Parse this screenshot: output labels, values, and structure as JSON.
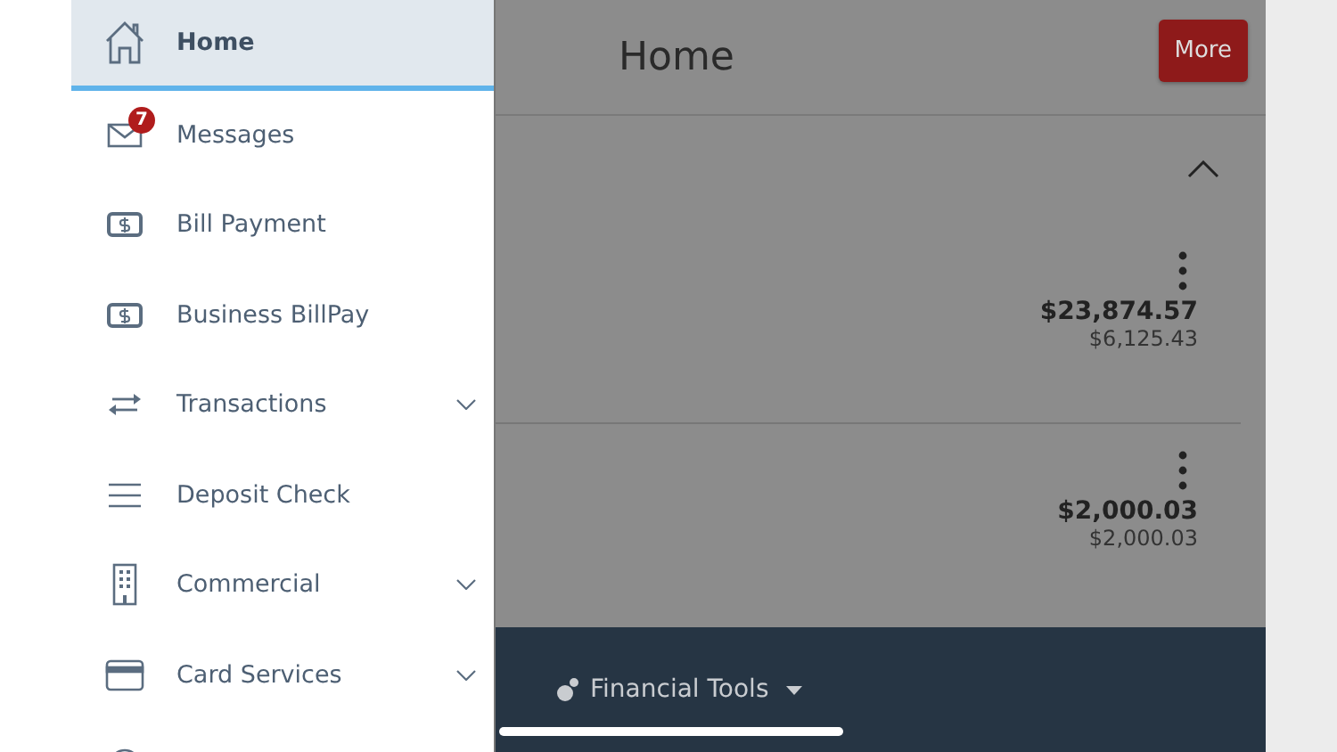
{
  "menu": [
    {
      "label": "Home",
      "kind": "house",
      "selected": true,
      "expandable": false
    },
    {
      "label": "Messages",
      "kind": "envelope",
      "selected": false,
      "expandable": false,
      "badge": "7"
    },
    {
      "label": "Bill Payment",
      "kind": "bill",
      "selected": false,
      "expandable": false
    },
    {
      "label": "Business BillPay",
      "kind": "bill",
      "selected": false,
      "expandable": false
    },
    {
      "label": "Transactions",
      "kind": "arrows",
      "selected": false,
      "expandable": true
    },
    {
      "label": "Deposit Check",
      "kind": "lines",
      "selected": false,
      "expandable": false
    },
    {
      "label": "Commercial",
      "kind": "building",
      "selected": false,
      "expandable": true
    },
    {
      "label": "Card Services",
      "kind": "card",
      "selected": false,
      "expandable": true
    }
  ],
  "header": {
    "title": "Home",
    "more_button": "More"
  },
  "accounts": [
    {
      "balance": "$23,874.57",
      "available": "$6,125.43"
    },
    {
      "balance": "$2,000.03",
      "available": "$2,000.03"
    }
  ],
  "footer": {
    "label": "Financial Tools"
  }
}
